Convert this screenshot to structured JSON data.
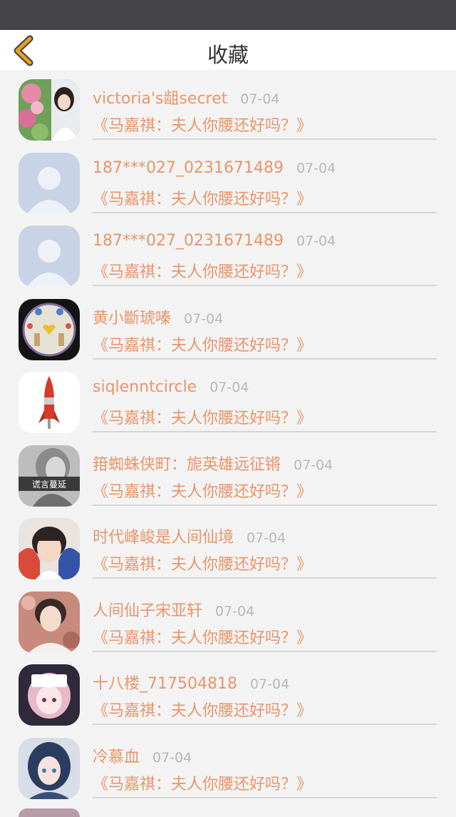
{
  "header": {
    "title": "收藏",
    "back_icon": "chevron-left-icon",
    "back_color": "#e8a020"
  },
  "colors": {
    "accent": "#e8956a",
    "date": "#b8b8b8",
    "status_bar": "#444446"
  },
  "favorites": [
    {
      "name": "victoria's龃secret",
      "date": "07-04",
      "article": "《马嘉祺：夫人你腰还好吗？》",
      "avatar": "photo-avatar"
    },
    {
      "name": "187***027_0231671489",
      "date": "07-04",
      "article": "《马嘉祺：夫人你腰还好吗？》",
      "avatar": "default-avatar"
    },
    {
      "name": "187***027_0231671489",
      "date": "07-04",
      "article": "《马嘉祺：夫人你腰还好吗？》",
      "avatar": "default-avatar"
    },
    {
      "name": "黄小斷琥嗪",
      "date": "07-04",
      "article": "《马嘉祺：夫人你腰还好吗？》",
      "avatar": "photo-avatar"
    },
    {
      "name": "siqlenntcircle",
      "date": "07-04",
      "article": "《马嘉祺：夫人你腰还好吗？》",
      "avatar": "rocket-avatar"
    },
    {
      "name": "箝蜘蛛侠町：旎英雄远征锵",
      "date": "07-04",
      "article": "《马嘉祺：夫人你腰还好吗？》",
      "avatar": "photo-avatar",
      "avatar_caption": "谎言蔓延"
    },
    {
      "name": "时代峰峻是人间仙境",
      "date": "07-04",
      "article": "《马嘉祺：夫人你腰还好吗？》",
      "avatar": "photo-avatar"
    },
    {
      "name": "人间仙子宋亚轩",
      "date": "07-04",
      "article": "《马嘉祺：夫人你腰还好吗？》",
      "avatar": "photo-avatar"
    },
    {
      "name": "十八楼_717504818",
      "date": "07-04",
      "article": "《马嘉祺：夫人你腰还好吗？》",
      "avatar": "photo-avatar"
    },
    {
      "name": "冷慕血",
      "date": "07-04",
      "article": "《马嘉祺：夫人你腰还好吗？》",
      "avatar": "photo-avatar"
    }
  ]
}
